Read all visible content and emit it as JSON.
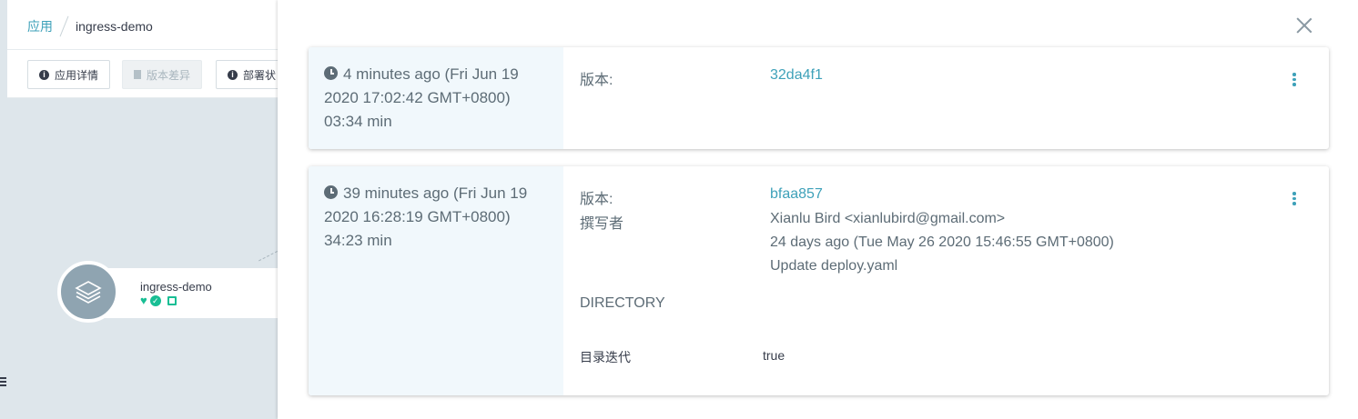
{
  "breadcrumb": {
    "root": "应用",
    "current": "ingress-demo"
  },
  "toolbar": {
    "details": "应用详情",
    "diff": "版本差异",
    "deploy": "部署状"
  },
  "node": {
    "name": "ingress-demo",
    "health": "healthy",
    "sync": "synced"
  },
  "history": [
    {
      "time_line1": "4 minutes ago (Fri Jun 19",
      "time_line2": "2020 17:02:42 GMT+0800)",
      "duration": "03:34 min",
      "revision_label": "版本:",
      "revision": "32da4f1"
    },
    {
      "time_line1": "39 minutes ago (Fri Jun 19",
      "time_line2": "2020 16:28:19 GMT+0800)",
      "duration": "34:23 min",
      "revision_label": "版本:",
      "revision": "bfaa857",
      "author_label": "撰写者",
      "author": "Xianlu Bird <xianlubird@gmail.com>",
      "commit_date": "24 days ago (Tue May 26 2020 15:46:55 GMT+0800)",
      "message": "Update deploy.yaml",
      "source_type": "DIRECTORY",
      "recurse_label": "目录迭代",
      "recurse_value": "true"
    }
  ],
  "colors": {
    "accent": "#3ea1b9",
    "healthy": "#18be94",
    "card_left_bg": "#f1f8fc"
  }
}
